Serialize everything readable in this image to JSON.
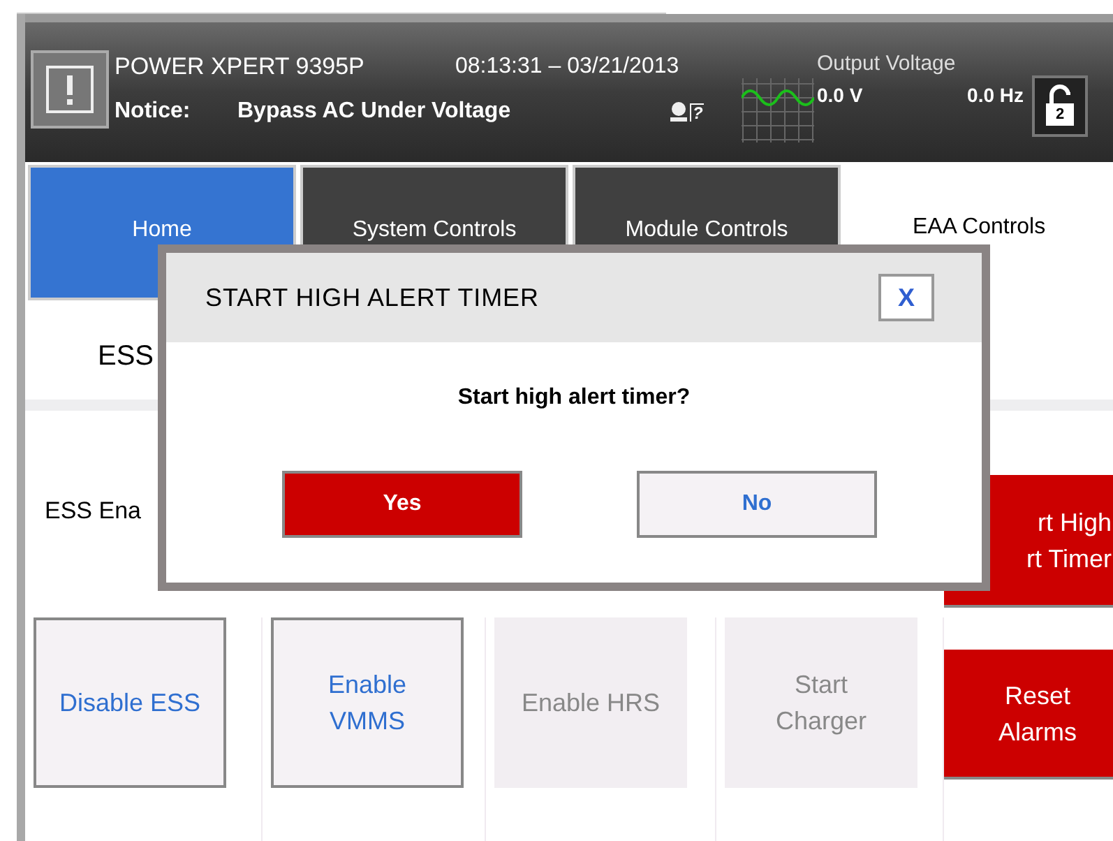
{
  "header": {
    "product": "POWER XPERT 9395P",
    "datetime": "08:13:31 – 03/21/2013",
    "notice_label": "Notice:",
    "notice": "Bypass AC Under Voltage",
    "help_mark": "?",
    "output_label": "Output Voltage",
    "voltage": "0.0 V",
    "frequency": "0.0 Hz",
    "lock_level": "2"
  },
  "tabs": [
    {
      "label": "Home",
      "kind": "home",
      "selected": false
    },
    {
      "label": "System Controls",
      "kind": "nav",
      "selected": false
    },
    {
      "label": "Module Controls",
      "kind": "nav",
      "selected": false
    },
    {
      "label": "EAA Controls",
      "kind": "nav",
      "selected": true
    }
  ],
  "section_heading": "ESS",
  "row_label": "ESS Ena",
  "side_button": {
    "lines": [
      "rt High",
      "rt Timer"
    ],
    "kind": "alert"
  },
  "buttons": [
    {
      "lines": [
        "Disable ESS"
      ],
      "kind": "standard",
      "disabled": false
    },
    {
      "lines": [
        "Enable",
        "VMMS"
      ],
      "kind": "standard",
      "disabled": false
    },
    {
      "lines": [
        "Enable HRS"
      ],
      "kind": "standard",
      "disabled": true
    },
    {
      "lines": [
        "Start",
        "Charger"
      ],
      "kind": "standard",
      "disabled": true
    },
    {
      "lines": [
        "Reset",
        "Alarms"
      ],
      "kind": "alert",
      "disabled": false
    }
  ],
  "dialog": {
    "title": "START HIGH ALERT TIMER",
    "close": "X",
    "message": "Start high alert timer?",
    "actions": [
      {
        "label": "Yes",
        "kind": "primary"
      },
      {
        "label": "No",
        "kind": "secondary"
      }
    ]
  }
}
